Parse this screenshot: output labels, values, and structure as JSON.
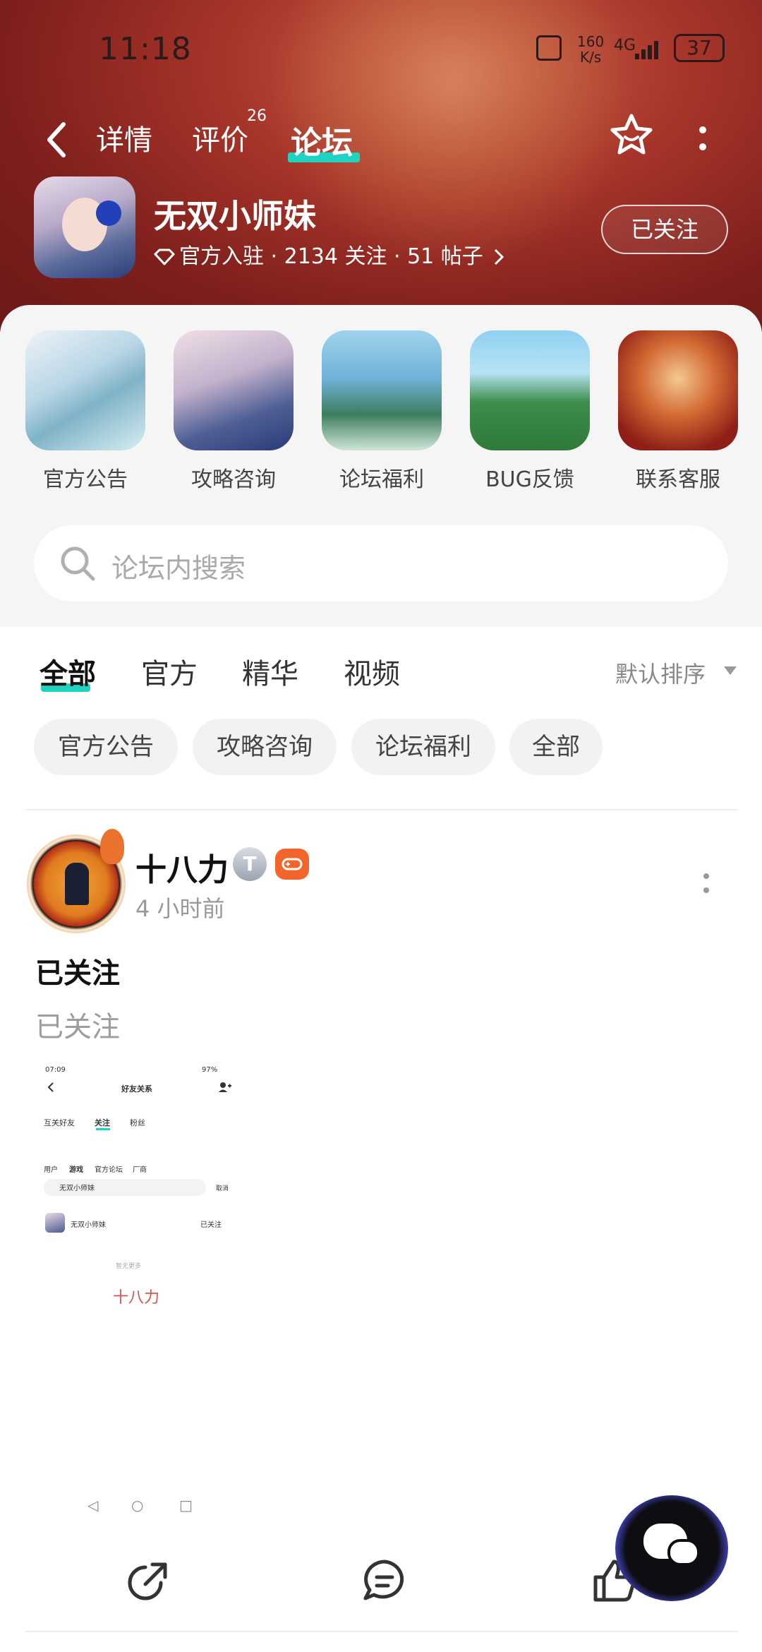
{
  "status_bar": {
    "time": "11:18",
    "net_speed": "160",
    "net_unit": "K/s",
    "signal": "4G",
    "battery": "37"
  },
  "nav": {
    "tabs": [
      {
        "label": "详情"
      },
      {
        "label": "评价"
      },
      {
        "label": "论坛"
      }
    ],
    "review_count": "26",
    "active_tab": "论坛"
  },
  "game": {
    "name": "无双小师妹",
    "meta": "官方入驻 · 2134 关注 · 51 帖子",
    "follow_label": "已关注"
  },
  "categories": [
    {
      "label": "官方公告"
    },
    {
      "label": "攻略咨询"
    },
    {
      "label": "论坛福利"
    },
    {
      "label": "BUG反馈"
    },
    {
      "label": "联系客服"
    }
  ],
  "search": {
    "placeholder": "论坛内搜索"
  },
  "feed_tabs": [
    {
      "label": "全部"
    },
    {
      "label": "官方"
    },
    {
      "label": "精华"
    },
    {
      "label": "视频"
    }
  ],
  "sort_label": "默认排序",
  "chips": [
    {
      "label": "官方公告"
    },
    {
      "label": "攻略咨询"
    },
    {
      "label": "论坛福利"
    },
    {
      "label": "全部"
    }
  ],
  "post": {
    "author": "十八力",
    "level": "T",
    "time": "4 小时前",
    "title": "已关注",
    "body": "已关注",
    "screenshot": {
      "time": "07:09",
      "battery": "97%",
      "title": "好友关系",
      "tabs": [
        "互关好友",
        "关注",
        "粉丝"
      ],
      "subtabs": [
        "用户",
        "游戏",
        "官方论坛",
        "厂商"
      ],
      "search_value": "无双小师妹",
      "cancel": "取消",
      "result_name": "无双小师妹",
      "result_status": "已关注",
      "no_more": "暂无更多",
      "watermark": "十八力"
    }
  },
  "colors": {
    "accent": "#1fd3c0",
    "header_bg": "#a8352a",
    "panel_bg": "#f5f5f6"
  }
}
